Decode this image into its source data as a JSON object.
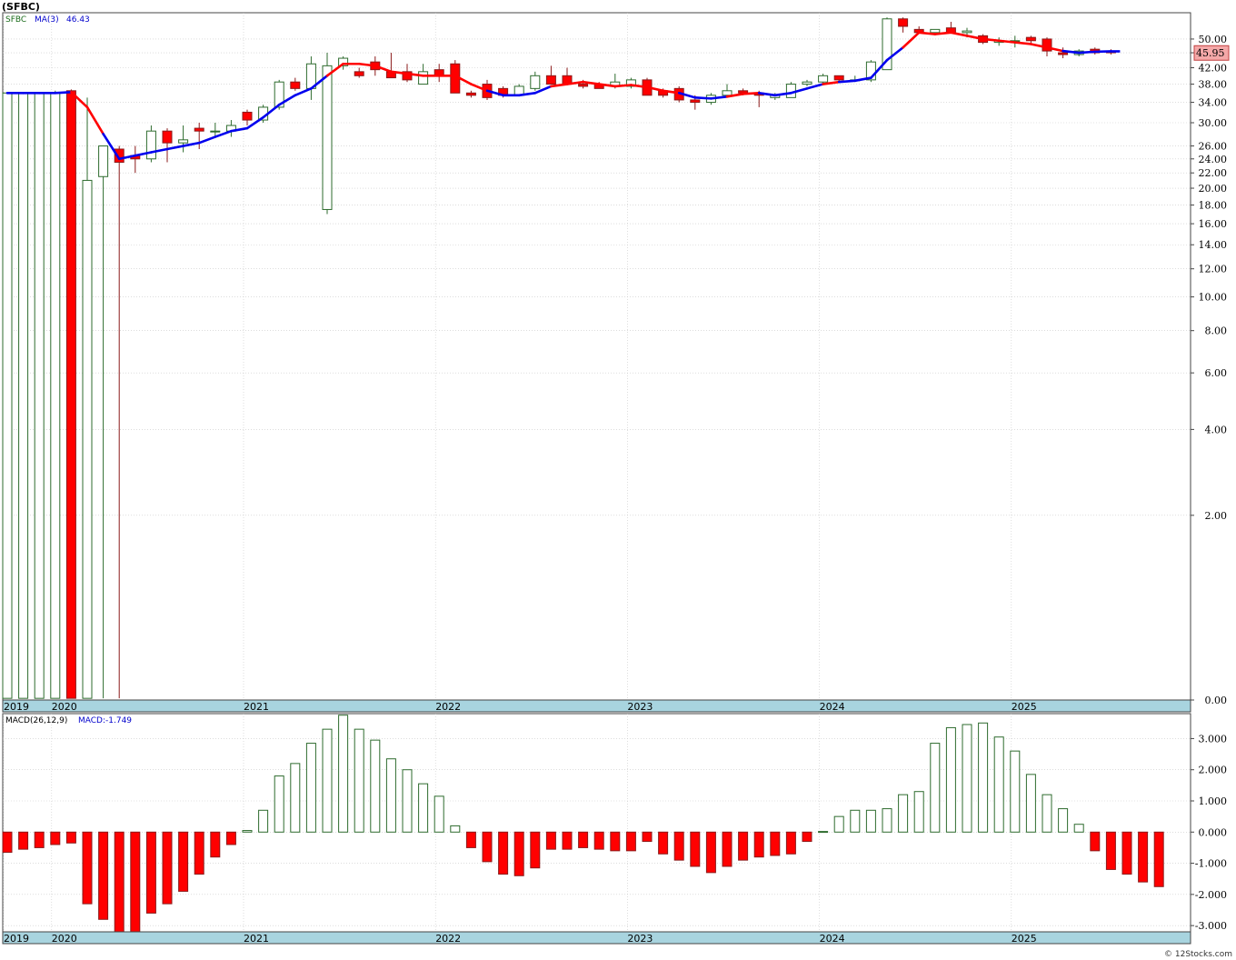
{
  "chart_title": "(SFBC)",
  "watermark": "© 12Stocks.com",
  "colors": {
    "up": "#2e6b2e",
    "down": "#ff0000",
    "ma_up": "#0000ee",
    "ma_down": "#ff0000",
    "axis_band": "#a8d4df",
    "grid": "#c8c8c8",
    "price_badge": "#f4a8a8"
  },
  "chart_data": [
    {
      "type": "candlestick",
      "header": {
        "symbol": "SFBC",
        "ma_label": "MA(3)",
        "ma_value": "46.43"
      },
      "scale": "log",
      "y_ticks": [
        "50.00",
        "46.00",
        "42.00",
        "38.00",
        "34.00",
        "30.00",
        "26.00",
        "24.00",
        "22.00",
        "20.00",
        "18.00",
        "16.00",
        "14.00",
        "12.00",
        "10.00",
        "8.00",
        "6.00",
        "4.00",
        "2.00",
        "0.00"
      ],
      "last_price_label": "45.95",
      "x_labels": [
        "2019",
        "2020",
        "2021",
        "2022",
        "2023",
        "2024",
        "2025"
      ],
      "candles": [
        {
          "o": 0.01,
          "h": 36.0,
          "l": 0.01,
          "c": 36.0
        },
        {
          "o": 0.01,
          "h": 36.0,
          "l": 0.01,
          "c": 36.0
        },
        {
          "o": 0.01,
          "h": 36.0,
          "l": 0.01,
          "c": 36.0
        },
        {
          "o": 0.01,
          "h": 36.5,
          "l": 0.01,
          "c": 36.0
        },
        {
          "o": 36.5,
          "h": 36.8,
          "l": 0.01,
          "c": 0.01
        },
        {
          "o": 0.01,
          "h": 35.0,
          "l": 0.01,
          "c": 21.0
        },
        {
          "o": 21.5,
          "h": 26.0,
          "l": 0.01,
          "c": 26.0
        },
        {
          "o": 25.5,
          "h": 26.0,
          "l": 0.01,
          "c": 23.5
        },
        {
          "o": 24.5,
          "h": 26.0,
          "l": 22.0,
          "c": 24.0
        },
        {
          "o": 24.0,
          "h": 29.5,
          "l": 23.5,
          "c": 28.5
        },
        {
          "o": 28.5,
          "h": 29.0,
          "l": 23.5,
          "c": 26.5
        },
        {
          "o": 26.5,
          "h": 29.5,
          "l": 25.0,
          "c": 27.0
        },
        {
          "o": 29.0,
          "h": 30.0,
          "l": 25.5,
          "c": 28.5
        },
        {
          "o": 28.5,
          "h": 30.0,
          "l": 27.5,
          "c": 28.5
        },
        {
          "o": 28.5,
          "h": 30.5,
          "l": 27.5,
          "c": 29.5
        },
        {
          "o": 32.0,
          "h": 32.5,
          "l": 29.5,
          "c": 30.5
        },
        {
          "o": 30.5,
          "h": 33.5,
          "l": 30.0,
          "c": 33.0
        },
        {
          "o": 33.0,
          "h": 39.0,
          "l": 32.5,
          "c": 38.5
        },
        {
          "o": 38.5,
          "h": 39.5,
          "l": 36.5,
          "c": 37.0
        },
        {
          "o": 37.0,
          "h": 45.0,
          "l": 34.5,
          "c": 43.0
        },
        {
          "o": 17.5,
          "h": 46.0,
          "l": 17.0,
          "c": 42.5
        },
        {
          "o": 42.5,
          "h": 45.0,
          "l": 41.5,
          "c": 44.5
        },
        {
          "o": 41.0,
          "h": 42.0,
          "l": 39.5,
          "c": 40.0
        },
        {
          "o": 43.5,
          "h": 45.0,
          "l": 40.0,
          "c": 41.5
        },
        {
          "o": 41.0,
          "h": 46.0,
          "l": 39.5,
          "c": 39.5
        },
        {
          "o": 41.0,
          "h": 43.0,
          "l": 38.5,
          "c": 39.0
        },
        {
          "o": 38.0,
          "h": 43.0,
          "l": 38.0,
          "c": 41.0
        },
        {
          "o": 41.5,
          "h": 43.0,
          "l": 38.5,
          "c": 40.0
        },
        {
          "o": 43.0,
          "h": 44.0,
          "l": 36.0,
          "c": 36.0
        },
        {
          "o": 36.0,
          "h": 36.5,
          "l": 35.0,
          "c": 35.5
        },
        {
          "o": 38.0,
          "h": 39.0,
          "l": 34.5,
          "c": 35.0
        },
        {
          "o": 37.0,
          "h": 37.5,
          "l": 35.0,
          "c": 35.5
        },
        {
          "o": 35.5,
          "h": 38.0,
          "l": 35.5,
          "c": 37.5
        },
        {
          "o": 37.0,
          "h": 41.0,
          "l": 36.5,
          "c": 40.0
        },
        {
          "o": 40.0,
          "h": 42.5,
          "l": 38.0,
          "c": 38.0
        },
        {
          "o": 40.0,
          "h": 42.0,
          "l": 38.0,
          "c": 38.0
        },
        {
          "o": 38.0,
          "h": 39.0,
          "l": 37.0,
          "c": 37.5
        },
        {
          "o": 38.0,
          "h": 38.5,
          "l": 37.0,
          "c": 37.0
        },
        {
          "o": 37.5,
          "h": 40.5,
          "l": 37.0,
          "c": 38.5
        },
        {
          "o": 37.5,
          "h": 39.5,
          "l": 37.0,
          "c": 39.0
        },
        {
          "o": 39.0,
          "h": 39.5,
          "l": 35.5,
          "c": 35.5
        },
        {
          "o": 36.5,
          "h": 37.0,
          "l": 35.0,
          "c": 35.5
        },
        {
          "o": 37.0,
          "h": 37.5,
          "l": 34.0,
          "c": 34.5
        },
        {
          "o": 34.5,
          "h": 35.5,
          "l": 32.5,
          "c": 34.0
        },
        {
          "o": 34.0,
          "h": 36.0,
          "l": 33.5,
          "c": 35.5
        },
        {
          "o": 35.5,
          "h": 38.0,
          "l": 35.0,
          "c": 36.5
        },
        {
          "o": 36.5,
          "h": 37.0,
          "l": 35.5,
          "c": 36.0
        },
        {
          "o": 36.0,
          "h": 36.5,
          "l": 33.0,
          "c": 35.5
        },
        {
          "o": 35.0,
          "h": 36.0,
          "l": 34.5,
          "c": 35.5
        },
        {
          "o": 35.0,
          "h": 38.5,
          "l": 35.0,
          "c": 38.0
        },
        {
          "o": 38.0,
          "h": 39.0,
          "l": 37.5,
          "c": 38.5
        },
        {
          "o": 38.5,
          "h": 40.5,
          "l": 38.0,
          "c": 40.0
        },
        {
          "o": 40.0,
          "h": 40.0,
          "l": 38.5,
          "c": 39.0
        },
        {
          "o": 39.0,
          "h": 40.0,
          "l": 38.5,
          "c": 39.0
        },
        {
          "o": 39.0,
          "h": 44.0,
          "l": 38.5,
          "c": 43.5
        },
        {
          "o": 41.5,
          "h": 57.0,
          "l": 41.5,
          "c": 56.5
        },
        {
          "o": 56.5,
          "h": 57.0,
          "l": 52.0,
          "c": 54.0
        },
        {
          "o": 53.0,
          "h": 54.0,
          "l": 52.5,
          "c": 52.0
        },
        {
          "o": 52.0,
          "h": 53.0,
          "l": 52.5,
          "c": 53.0
        },
        {
          "o": 53.5,
          "h": 55.5,
          "l": 52.5,
          "c": 52.0
        },
        {
          "o": 52.0,
          "h": 53.5,
          "l": 50.5,
          "c": 52.5
        },
        {
          "o": 51.0,
          "h": 51.5,
          "l": 48.5,
          "c": 49.0
        },
        {
          "o": 49.0,
          "h": 50.5,
          "l": 48.0,
          "c": 49.5
        },
        {
          "o": 49.5,
          "h": 51.0,
          "l": 47.5,
          "c": 49.5
        },
        {
          "o": 50.5,
          "h": 51.0,
          "l": 48.5,
          "c": 49.5
        },
        {
          "o": 50.0,
          "h": 50.5,
          "l": 45.0,
          "c": 46.5
        },
        {
          "o": 46.0,
          "h": 47.5,
          "l": 44.5,
          "c": 45.5
        },
        {
          "o": 45.5,
          "h": 47.0,
          "l": 45.0,
          "c": 46.5
        },
        {
          "o": 47.0,
          "h": 47.5,
          "l": 45.5,
          "c": 46.0
        },
        {
          "o": 46.5,
          "h": 47.0,
          "l": 45.5,
          "c": 46.0
        }
      ],
      "ma3": [
        36.0,
        36.0,
        36.0,
        36.0,
        36.2,
        33.0,
        28.0,
        24.0,
        24.5,
        25.0,
        25.5,
        26.0,
        26.5,
        27.5,
        28.5,
        29.0,
        31.0,
        33.5,
        35.5,
        37.0,
        40.0,
        43.0,
        43.0,
        42.5,
        41.0,
        40.5,
        40.0,
        40.0,
        40.0,
        38.0,
        36.5,
        35.5,
        35.5,
        36.0,
        37.5,
        38.0,
        38.5,
        38.0,
        37.5,
        37.8,
        37.3,
        36.5,
        36.0,
        35.0,
        34.8,
        35.2,
        35.8,
        36.0,
        35.5,
        36.0,
        37.0,
        38.0,
        38.5,
        38.8,
        39.5,
        44.0,
        47.5,
        52.0,
        51.5,
        52.0,
        51.0,
        50.0,
        49.5,
        49.0,
        48.5,
        47.5,
        46.5,
        46.0,
        46.3,
        46.4
      ],
      "ma3_colors": [
        "up",
        "up",
        "up",
        "up",
        "up",
        "down",
        "down",
        "up",
        "up",
        "up",
        "up",
        "up",
        "up",
        "up",
        "up",
        "up",
        "up",
        "up",
        "up",
        "up",
        "up",
        "down",
        "down",
        "down",
        "down",
        "down",
        "down",
        "down",
        "down",
        "down",
        "down",
        "up",
        "up",
        "up",
        "up",
        "down",
        "down",
        "down",
        "down",
        "down",
        "down",
        "down",
        "down",
        "up",
        "up",
        "up",
        "down",
        "down",
        "up",
        "up",
        "up",
        "up",
        "down",
        "up",
        "up",
        "up",
        "up",
        "down",
        "down",
        "down",
        "down",
        "down",
        "down",
        "down",
        "down",
        "down",
        "down",
        "up",
        "up",
        "up"
      ]
    },
    {
      "type": "bar",
      "header": {
        "indicator": "MACD(26,12,9)",
        "value_label": "MACD:-1.749"
      },
      "y_ticks": [
        "3.000",
        "2.000",
        "1.000",
        "0.000",
        "-1.000",
        "-2.000",
        "-3.000"
      ],
      "ylim": [
        -3.2,
        3.8
      ],
      "x_labels": [
        "2019",
        "2020",
        "2021",
        "2022",
        "2023",
        "2024",
        "2025"
      ],
      "values": [
        -0.65,
        -0.55,
        -0.5,
        -0.4,
        -0.35,
        -2.3,
        -2.8,
        -3.2,
        -3.2,
        -2.6,
        -2.3,
        -1.9,
        -1.35,
        -0.8,
        -0.4,
        0.05,
        0.7,
        1.8,
        2.2,
        2.85,
        3.3,
        3.75,
        3.3,
        2.95,
        2.35,
        2.0,
        1.55,
        1.15,
        0.2,
        -0.5,
        -0.95,
        -1.35,
        -1.4,
        -1.15,
        -0.55,
        -0.55,
        -0.5,
        -0.55,
        -0.6,
        -0.6,
        -0.3,
        -0.7,
        -0.9,
        -1.1,
        -1.3,
        -1.1,
        -0.9,
        -0.8,
        -0.75,
        -0.7,
        -0.3,
        0.02,
        0.5,
        0.7,
        0.7,
        0.75,
        1.2,
        1.3,
        2.85,
        3.35,
        3.45,
        3.5,
        3.05,
        2.6,
        1.85,
        1.2,
        0.75,
        0.25,
        -0.6,
        -1.2,
        -1.35,
        -1.6,
        -1.75
      ]
    }
  ]
}
